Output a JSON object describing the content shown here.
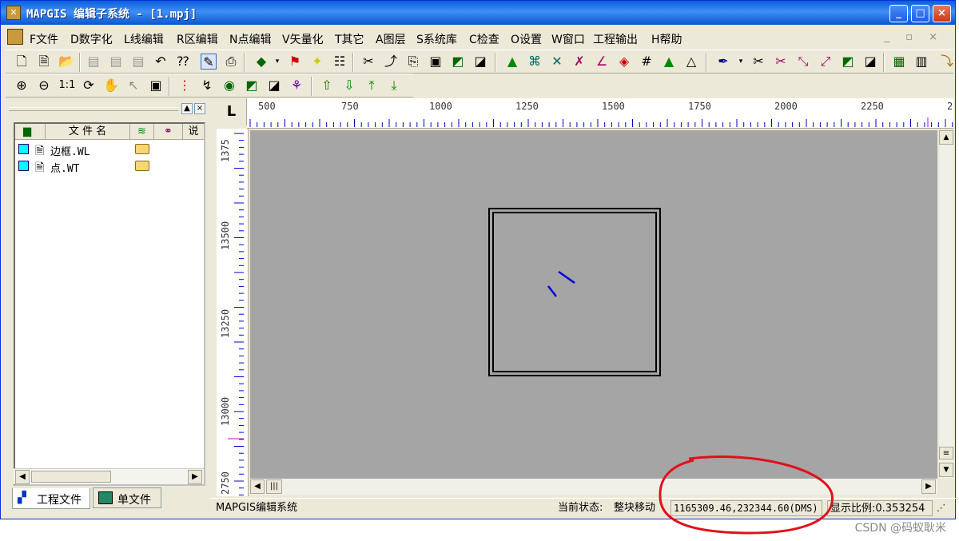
{
  "window": {
    "title": "MAPGIS 编辑子系统 - [1.mpj]",
    "minimize": "_",
    "maximize": "□",
    "close": "×"
  },
  "menubar": {
    "items": [
      "F文件",
      "D数字化",
      "L线编辑",
      "R区编辑",
      "N点编辑",
      "V矢量化",
      "T其它",
      "A图层",
      "S系统库",
      "C检查",
      "O设置",
      "W窗口",
      "工程输出",
      "H帮助"
    ],
    "mdi_controls": "_ ▫ ×"
  },
  "toolbar2": {
    "zoom_ratio": "1:1"
  },
  "panel": {
    "header": {
      "file_name": "文 件 名",
      "description": "说"
    },
    "files": [
      {
        "name": "边框.WL"
      },
      {
        "name": "点.WT"
      }
    ],
    "tabs": [
      "工程文件",
      "单文件"
    ]
  },
  "canvas": {
    "corner": "L",
    "top_ruler_labels": [
      "500",
      "750",
      "1000",
      "1250",
      "1500",
      "1750",
      "2000",
      "2250",
      "2"
    ],
    "left_ruler_labels": [
      "1375",
      "13500",
      "13250",
      "13000",
      "2750"
    ]
  },
  "status": {
    "app": "MAPGIS编辑系统",
    "state_label": "当前状态:",
    "state_value": "整块移动",
    "coords": "1165309.46,232344.60(DMS)",
    "scale": "显示比例:0.353254"
  },
  "watermark": "CSDN @码蚁耿米",
  "colors": {
    "title": "#0a5fd8",
    "canvas": "#a5a5a5",
    "highlight": "#e0101a",
    "feature": "#0000e0"
  }
}
